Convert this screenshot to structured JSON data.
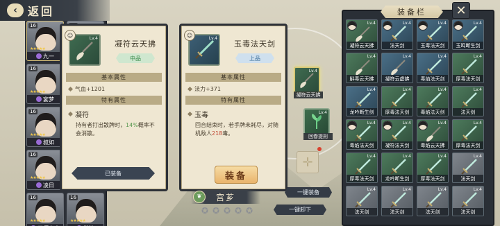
{
  "header": {
    "back_label": "返回"
  },
  "roster": {
    "col1": [
      {
        "level": "16",
        "name": "九一"
      },
      {
        "level": "16",
        "name": "宴梦"
      },
      {
        "level": "16",
        "name": "叔如"
      },
      {
        "level": "16",
        "name": "凌日"
      },
      {
        "level": "16",
        "name": "天师上人"
      }
    ],
    "col2": [
      {
        "level": "18",
        "name": ""
      },
      {
        "level": "16",
        "name": ""
      },
      {
        "level": "16",
        "name": ""
      },
      {
        "level": "16",
        "name": ""
      },
      {
        "level": "16",
        "name": "觉清"
      }
    ]
  },
  "card_left": {
    "title": "凝符云天拂",
    "grade": "中品",
    "level": "Lv.4",
    "basic_header": "基本属性",
    "stat": "气血+1201",
    "special_header": "特有属性",
    "attr_name": "凝符",
    "attr_desc_a": "持有者打出散牌时，",
    "attr_desc_pct": "14%",
    "attr_desc_b": "概率不会消散。",
    "button": "已装备"
  },
  "card_right": {
    "title": "玉毒法天剑",
    "grade": "上品",
    "level": "Lv.4",
    "basic_header": "基本属性",
    "stat": "法力+371",
    "special_header": "特有属性",
    "attr_name": "玉毒",
    "attr_desc_a": "回合结束时，若手牌未耗尽，对随机敌人",
    "attr_desc_val": "218",
    "attr_desc_b": "毒。",
    "button": "装备"
  },
  "center": {
    "slot_a": {
      "level": "Lv.4",
      "name": "凝符云天拂"
    },
    "slot_b": {
      "level": "Lv.4",
      "name": "回春提刑"
    },
    "equip_all": "一键装备",
    "unequip_all": "一键卸下",
    "hero_name": "宫芗",
    "star_count": 5
  },
  "equip_panel": {
    "title": "装备栏",
    "items": [
      {
        "name": "凝符云天拂",
        "level": "Lv.4",
        "tone": "green",
        "avatar": true
      },
      {
        "name": "法天剑",
        "level": "Lv.4",
        "tone": "blue",
        "avatar": true
      },
      {
        "name": "玉毒法天剑",
        "level": "Lv.4",
        "tone": "blue",
        "avatar": true
      },
      {
        "name": "玉鸣断生剑",
        "level": "Lv.4",
        "tone": "blue",
        "avatar": true
      },
      {
        "name": "斛毒云天拂",
        "level": "Lv.4",
        "tone": "green",
        "avatar": false
      },
      {
        "name": "凝符云虚拂",
        "level": "Lv.4",
        "tone": "blue",
        "avatar": false
      },
      {
        "name": "毒焰法天剑",
        "level": "Lv.4",
        "tone": "blue",
        "avatar": false
      },
      {
        "name": "厚毒法天剑",
        "level": "Lv.4",
        "tone": "green",
        "avatar": false
      },
      {
        "name": "龙吟断生剑",
        "level": "Lv.4",
        "tone": "blue",
        "avatar": false
      },
      {
        "name": "厚毒法天剑",
        "level": "Lv.4",
        "tone": "green",
        "avatar": false
      },
      {
        "name": "毒焰法天剑",
        "level": "Lv.4",
        "tone": "green",
        "avatar": false
      },
      {
        "name": "法天剑",
        "level": "Lv.4",
        "tone": "green",
        "avatar": false
      },
      {
        "name": "毒焰法天剑",
        "level": "Lv.4",
        "tone": "green",
        "avatar": true
      },
      {
        "name": "凝符法天剑",
        "level": "Lv.4",
        "tone": "green",
        "avatar": true
      },
      {
        "name": "毒焰云天拂",
        "level": "Lv.4",
        "tone": "green",
        "avatar": true
      },
      {
        "name": "厚毒法天剑",
        "level": "Lv.4",
        "tone": "green",
        "avatar": false
      },
      {
        "name": "厚毒法天剑",
        "level": "Lv.4",
        "tone": "green",
        "avatar": false
      },
      {
        "name": "龙吟断生剑",
        "level": "Lv.4",
        "tone": "green",
        "avatar": false
      },
      {
        "name": "厚毒法天剑",
        "level": "Lv.4",
        "tone": "green",
        "avatar": false
      },
      {
        "name": "法天剑",
        "level": "Lv.4",
        "tone": "gray",
        "avatar": false
      },
      {
        "name": "法天剑",
        "level": "Lv.4",
        "tone": "gray",
        "avatar": false
      },
      {
        "name": "法天剑",
        "level": "Lv.4",
        "tone": "gray",
        "avatar": false
      },
      {
        "name": "法天剑",
        "level": "Lv.4",
        "tone": "gray",
        "avatar": false
      },
      {
        "name": "法天剑",
        "level": "Lv.4",
        "tone": "gray",
        "avatar": false
      }
    ]
  },
  "colors": {
    "accent_green": "#5a9a52",
    "accent_red": "#c24d3a",
    "panel_dark": "#2a2f36",
    "parchment": "#efe7d2"
  }
}
